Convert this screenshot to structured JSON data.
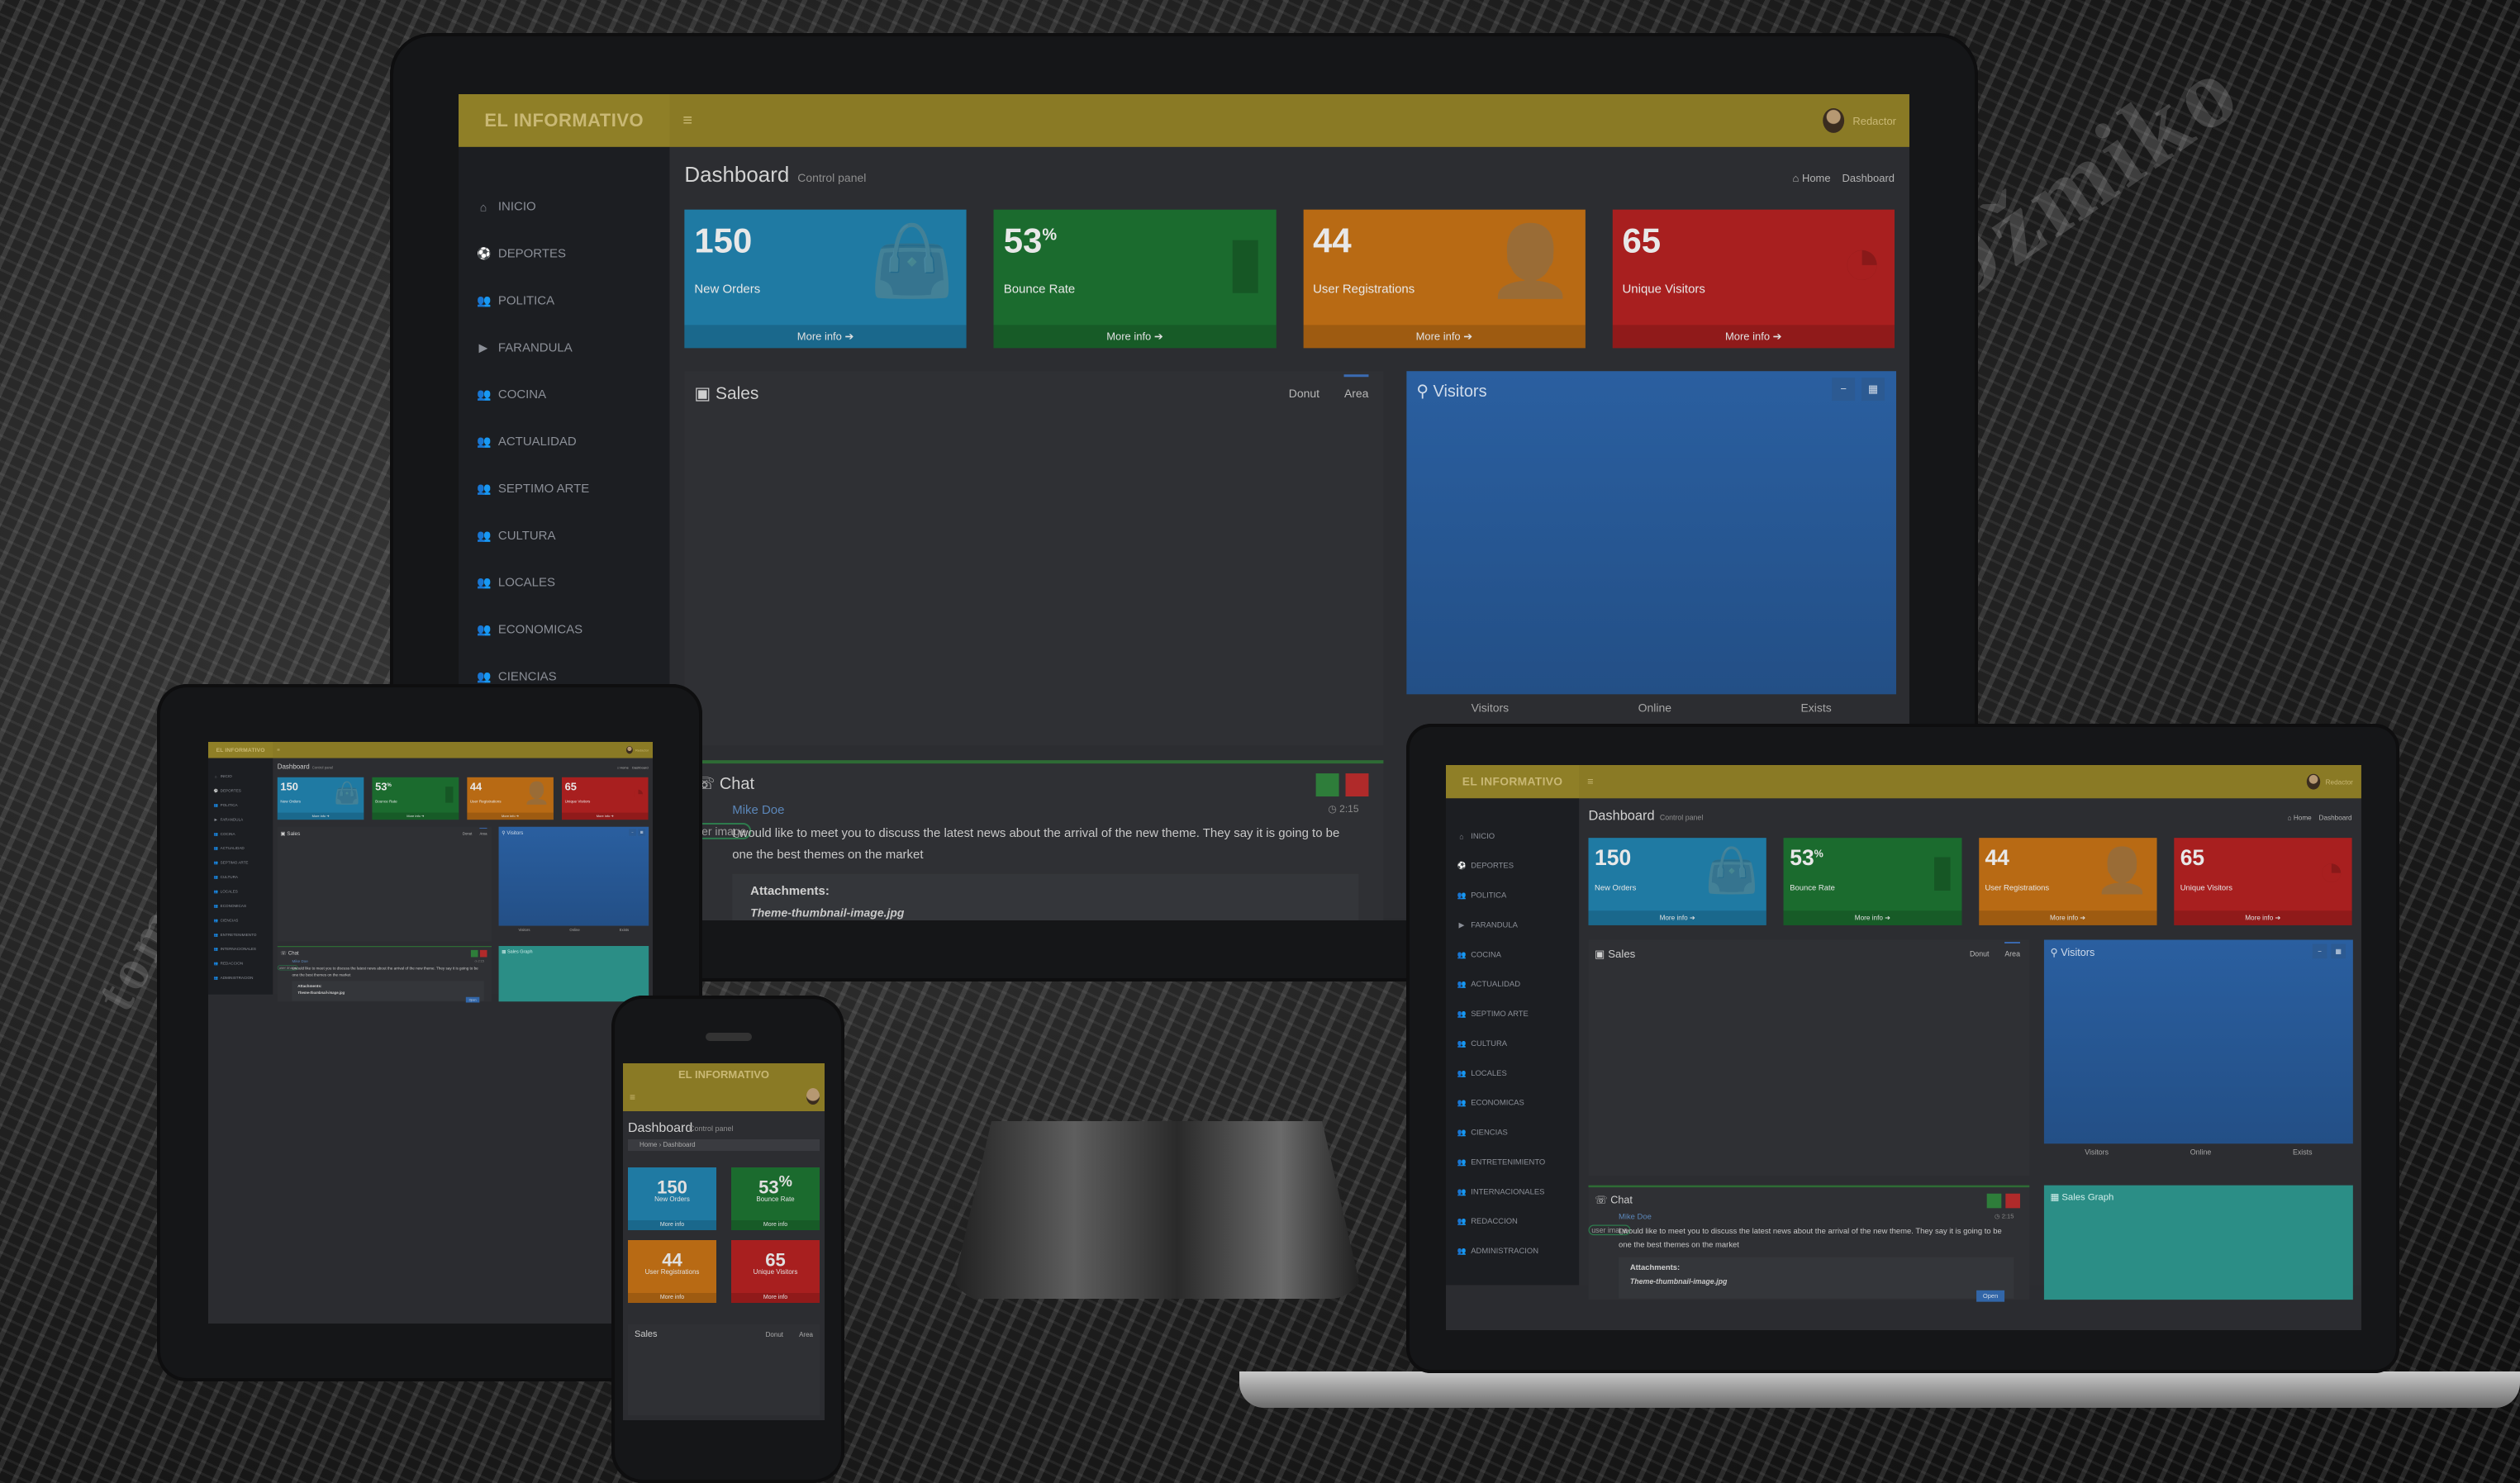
{
  "brand": "EL INFORMATIVO",
  "user_name": "Redactor",
  "page": {
    "title": "Dashboard",
    "subtitle": "Control panel"
  },
  "breadcrumb": {
    "home": "Home",
    "current": "Dashboard"
  },
  "sidebar_items": [
    "INICIO",
    "DEPORTES",
    "POLITICA",
    "FARANDULA",
    "COCINA",
    "ACTUALIDAD",
    "SEPTIMO ARTE",
    "CULTURA",
    "LOCALES",
    "ECONOMICAS",
    "CIENCIAS",
    "ENTRETENIMIENTO",
    "INTERNACIONALES",
    "REDACCION",
    "ADMINISTRACION"
  ],
  "stat_boxes": [
    {
      "value": "150",
      "suffix": "",
      "label": "New Orders",
      "more": "More info",
      "color": "#1f7aa3",
      "icon": "shopping-bag-icon"
    },
    {
      "value": "53",
      "suffix": "%",
      "label": "Bounce Rate",
      "more": "More info",
      "color": "#1b6b2e",
      "icon": "bar-chart-icon"
    },
    {
      "value": "44",
      "suffix": "",
      "label": "User Registrations",
      "more": "More info",
      "color": "#b86a14",
      "icon": "user-add-icon"
    },
    {
      "value": "65",
      "suffix": "",
      "label": "Unique Visitors",
      "more": "More info",
      "color": "#a81f1f",
      "icon": "pie-chart-icon"
    }
  ],
  "sales": {
    "title": "Sales",
    "tabs": [
      "Donut",
      "Area"
    ],
    "active_tab": "Area"
  },
  "visitors": {
    "title": "Visitors",
    "labels": [
      "Visitors",
      "Online",
      "Exists"
    ]
  },
  "chat": {
    "title": "Chat",
    "name": "Mike Doe",
    "time": "2:15",
    "alt": "user image",
    "message": "I would like to meet you to discuss the latest news about the arrival of the new theme. They say it is going to be one the best themes on the market",
    "attachments_label": "Attachments:",
    "file": "Theme-thumbnail-image.jpg",
    "open_label": "Open"
  },
  "sales_graph": {
    "title": "Sales Graph"
  }
}
